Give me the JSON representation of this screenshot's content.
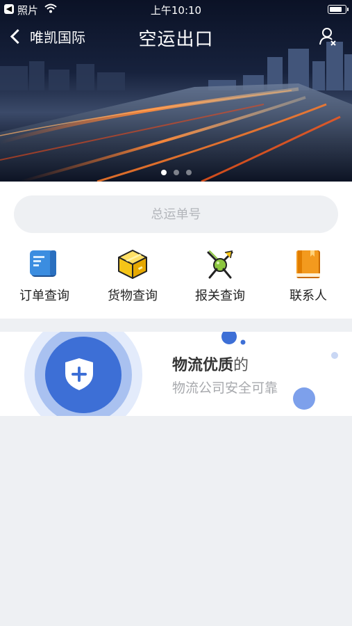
{
  "status_bar": {
    "back_app_label": "照片",
    "time": "上午10:10"
  },
  "nav": {
    "back_label": "唯凯国际",
    "title": "空运出口",
    "user_icon": "user-close-icon"
  },
  "carousel": {
    "slides_count": 3,
    "active_index": 0
  },
  "search": {
    "placeholder": "总运单号",
    "value": ""
  },
  "quick_actions": [
    {
      "label": "订单查询",
      "icon": "order-notebook-icon",
      "color": "#3b8de0"
    },
    {
      "label": "货物查询",
      "icon": "cargo-box-icon",
      "color": "#f5c518"
    },
    {
      "label": "报关查询",
      "icon": "customs-stamp-icon",
      "color": "#8cc63f"
    },
    {
      "label": "联系人",
      "icon": "contact-book-icon",
      "color": "#f39a1e"
    }
  ],
  "promo": {
    "title_bold": "物流优质",
    "title_light": "的",
    "subtitle": "物流公司安全可靠",
    "icon": "shield-plus-icon",
    "accent": "#3d6fd6"
  }
}
